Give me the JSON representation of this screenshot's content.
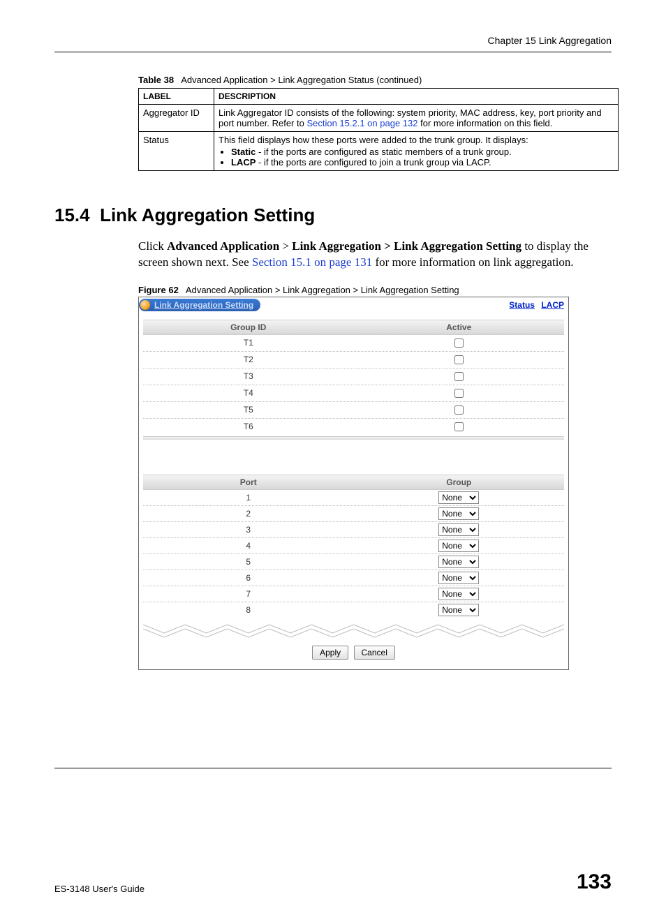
{
  "header": {
    "chapter": "Chapter 15 Link Aggregation"
  },
  "table38": {
    "caption_num": "Table 38",
    "caption_text": "Advanced Application > Link Aggregation Status  (continued)",
    "col_label": "LABEL",
    "col_desc": "DESCRIPTION",
    "row1": {
      "label": "Aggregator ID",
      "desc_pre": "Link Aggregator ID consists of the following: system priority, MAC address, key, port priority and port number. Refer to ",
      "desc_link": "Section 15.2.1 on page 132",
      "desc_post": " for more information on this field."
    },
    "row2": {
      "label": "Status",
      "intro": "This field displays how these ports were added to the trunk group. It displays:",
      "bullet1_b": "Static",
      "bullet1_t": " - if the ports are configured as static members of a trunk group.",
      "bullet2_b": "LACP",
      "bullet2_t": " - if the ports are configured to join a trunk group via LACP."
    }
  },
  "section": {
    "num": "15.4",
    "title": "Link Aggregation Setting",
    "para_pre": "Click ",
    "para_b1": "Advanced Application",
    "para_gt": " > ",
    "para_b2": "Link Aggregation > Link Aggregation Setting",
    "para_mid": " to display the screen shown next. See ",
    "para_link": "Section 15.1 on page 131",
    "para_post": " for more information on link aggregation."
  },
  "figure62": {
    "caption_num": "Figure 62",
    "caption_text": "Advanced Application > Link Aggregation > Link Aggregation Setting",
    "pill_title": "Link Aggregation Setting",
    "link_status": "Status",
    "link_lacp": "LACP",
    "groups": {
      "hdr_group": "Group ID",
      "hdr_active": "Active",
      "rows": [
        "T1",
        "T2",
        "T3",
        "T4",
        "T5",
        "T6"
      ]
    },
    "ports": {
      "hdr_port": "Port",
      "hdr_group": "Group",
      "rows": [
        "1",
        "2",
        "3",
        "4",
        "5",
        "6",
        "7",
        "8"
      ],
      "select_value": "None"
    },
    "btn_apply": "Apply",
    "btn_cancel": "Cancel"
  },
  "footer": {
    "guide": "ES-3148 User's Guide",
    "page": "133"
  }
}
